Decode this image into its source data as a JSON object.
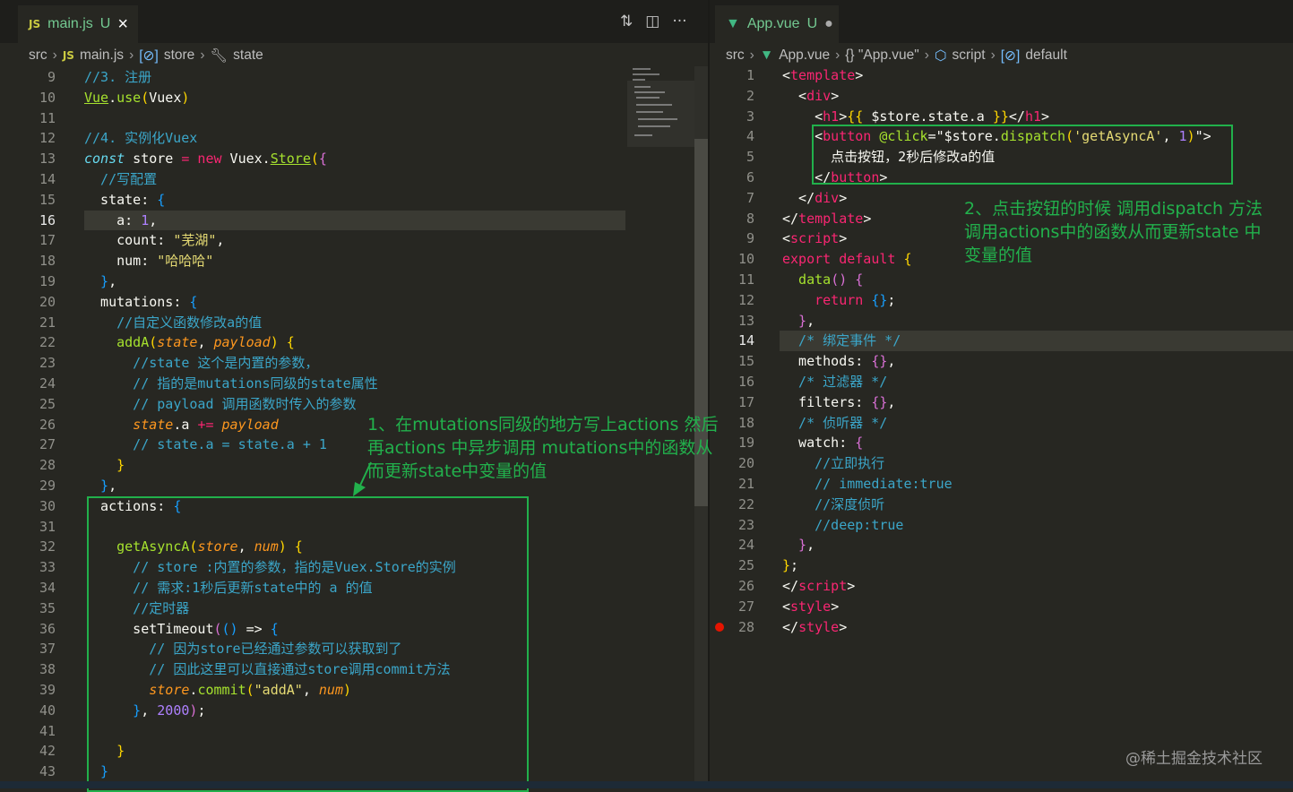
{
  "left": {
    "tab": {
      "icon": "js-icon",
      "label": "main.js",
      "status": "U",
      "close": "×"
    },
    "actions": [
      "compare-changes-icon",
      "split-editor-icon",
      "more-actions-icon"
    ],
    "breadcrumb": [
      "src",
      "main.js",
      "store",
      "state"
    ],
    "first_line": 9,
    "current_line": 16,
    "lines": [
      [
        [
          "//3. 注册",
          "c"
        ]
      ],
      [
        [
          "Vue",
          "f u"
        ],
        [
          ".",
          "w"
        ],
        [
          "use",
          "f"
        ],
        [
          "(",
          "b1"
        ],
        [
          "Vuex",
          "w"
        ],
        [
          ")",
          "b1"
        ]
      ],
      [],
      [
        [
          "//4. 实例化Vuex",
          "c"
        ]
      ],
      [
        [
          "const",
          "kc"
        ],
        [
          " store ",
          "w"
        ],
        [
          "=",
          "k"
        ],
        [
          " new",
          "k"
        ],
        [
          " Vuex.",
          "w"
        ],
        [
          "Store",
          "f u"
        ],
        [
          "(",
          "b1"
        ],
        [
          "{",
          "b2"
        ]
      ],
      [
        [
          "  //写配置",
          "c"
        ]
      ],
      [
        [
          "  state: ",
          "w"
        ],
        [
          "{",
          "b3"
        ]
      ],
      [
        [
          "    a: ",
          "w"
        ],
        [
          "1",
          "n"
        ],
        [
          ",",
          "w"
        ]
      ],
      [
        [
          "    count: ",
          "w"
        ],
        [
          "\"芜湖\"",
          "s"
        ],
        [
          ",",
          "w"
        ]
      ],
      [
        [
          "    num: ",
          "w"
        ],
        [
          "\"哈哈哈\"",
          "s"
        ]
      ],
      [
        [
          "  }",
          "b3"
        ],
        [
          ",",
          "w"
        ]
      ],
      [
        [
          "  mutations: ",
          "w"
        ],
        [
          "{",
          "b3"
        ]
      ],
      [
        [
          "    //自定义函数修改a的值",
          "c"
        ]
      ],
      [
        [
          "    addA",
          "f"
        ],
        [
          "(",
          "b1"
        ],
        [
          "state",
          "p"
        ],
        [
          ", ",
          "w"
        ],
        [
          "payload",
          "p"
        ],
        [
          ")",
          "b1"
        ],
        [
          " {",
          "b1"
        ]
      ],
      [
        [
          "      //state 这个是内置的参数，",
          "c"
        ]
      ],
      [
        [
          "      // 指的是mutations同级的state属性",
          "c"
        ]
      ],
      [
        [
          "      // payload 调用函数时传入的参数",
          "c"
        ]
      ],
      [
        [
          "      state",
          "p"
        ],
        [
          ".a ",
          "w"
        ],
        [
          "+=",
          "k"
        ],
        [
          " payload",
          "p"
        ]
      ],
      [
        [
          "      // state.a = state.a + 1",
          "c"
        ]
      ],
      [
        [
          "    }",
          "b1"
        ]
      ],
      [
        [
          "  }",
          "b3"
        ],
        [
          ",",
          "w"
        ]
      ],
      [
        [
          "  actions: ",
          "w"
        ],
        [
          "{",
          "b3"
        ]
      ],
      [],
      [
        [
          "    getAsyncA",
          "f"
        ],
        [
          "(",
          "b1"
        ],
        [
          "store",
          "p"
        ],
        [
          ", ",
          "w"
        ],
        [
          "num",
          "p"
        ],
        [
          ")",
          "b1"
        ],
        [
          " {",
          "b1"
        ]
      ],
      [
        [
          "      // store :内置的参数，指的是Vuex.Store的实例",
          "c"
        ]
      ],
      [
        [
          "      // 需求:1秒后更新state中的 a 的值",
          "c"
        ]
      ],
      [
        [
          "      //定时器",
          "c"
        ]
      ],
      [
        [
          "      setTimeout",
          "w"
        ],
        [
          "(",
          "b2"
        ],
        [
          "()",
          "b3"
        ],
        [
          " => ",
          "w"
        ],
        [
          "{",
          "b3"
        ]
      ],
      [
        [
          "        // 因为store已经通过参数可以获取到了",
          "c"
        ]
      ],
      [
        [
          "        // 因此这里可以直接通过store调用commit方法",
          "c"
        ]
      ],
      [
        [
          "        store",
          "p"
        ],
        [
          ".",
          "w"
        ],
        [
          "commit",
          "f"
        ],
        [
          "(",
          "b1"
        ],
        [
          "\"addA\"",
          "s"
        ],
        [
          ", ",
          "w"
        ],
        [
          "num",
          "p"
        ],
        [
          ")",
          "b1"
        ]
      ],
      [
        [
          "      }",
          "b3"
        ],
        [
          ", ",
          "w"
        ],
        [
          "2000",
          "n"
        ],
        [
          ")",
          "b2"
        ],
        [
          ";",
          "w"
        ]
      ],
      [],
      [
        [
          "    }",
          "b1"
        ]
      ],
      [
        [
          "  }",
          "b3"
        ]
      ]
    ],
    "annotation": "1、在mutations同级的地方写上actions 然后再actions 中异步调用 mutations中的函数从而更新state中变量的值"
  },
  "right": {
    "tab": {
      "icon": "vue-icon",
      "label": "App.vue",
      "status": "U",
      "modified": "●"
    },
    "breadcrumb": [
      "src",
      "App.vue",
      "{} \"App.vue\"",
      "script",
      "default"
    ],
    "first_line": 1,
    "current_line": 14,
    "breakpoint_line": 28,
    "lines": [
      [
        [
          "<",
          "w"
        ],
        [
          "template",
          "t"
        ],
        [
          ">",
          "w"
        ]
      ],
      [
        [
          "  <",
          "w"
        ],
        [
          "div",
          "t"
        ],
        [
          ">",
          "w"
        ]
      ],
      [
        [
          "    <",
          "w"
        ],
        [
          "h1",
          "t"
        ],
        [
          ">",
          "w"
        ],
        [
          "{{",
          "b1"
        ],
        [
          " $store.state.a ",
          "w"
        ],
        [
          "}}",
          "b1"
        ],
        [
          "</",
          "w"
        ],
        [
          "h1",
          "t"
        ],
        [
          ">",
          "w"
        ]
      ],
      [
        [
          "    <",
          "w"
        ],
        [
          "button",
          "t"
        ],
        [
          " @click",
          "f"
        ],
        [
          "=\"$store.",
          "w"
        ],
        [
          "dispatch",
          "f"
        ],
        [
          "(",
          "b1"
        ],
        [
          "'getAsyncA'",
          "s"
        ],
        [
          ", ",
          "w"
        ],
        [
          "1",
          "n"
        ],
        [
          ")",
          "b1"
        ],
        [
          "\">",
          "w"
        ]
      ],
      [
        [
          "      点击按钮，2秒后修改a的值",
          "w"
        ]
      ],
      [
        [
          "    </",
          "w"
        ],
        [
          "button",
          "t"
        ],
        [
          ">",
          "w"
        ]
      ],
      [
        [
          "  </",
          "w"
        ],
        [
          "div",
          "t"
        ],
        [
          ">",
          "w"
        ]
      ],
      [
        [
          "</",
          "w"
        ],
        [
          "template",
          "t"
        ],
        [
          ">",
          "w"
        ]
      ],
      [
        [
          "<",
          "w"
        ],
        [
          "script",
          "t"
        ],
        [
          ">",
          "w"
        ]
      ],
      [
        [
          "export default",
          "k"
        ],
        [
          " {",
          "b1"
        ]
      ],
      [
        [
          "  data",
          "f"
        ],
        [
          "()",
          "b2"
        ],
        [
          " {",
          "b2"
        ]
      ],
      [
        [
          "    return",
          "k"
        ],
        [
          " {}",
          "b3"
        ],
        [
          ";",
          "w"
        ]
      ],
      [
        [
          "  }",
          "b2"
        ],
        [
          ",",
          "w"
        ]
      ],
      [
        [
          "  /* 绑定事件 */",
          "c"
        ]
      ],
      [
        [
          "  methods: ",
          "w"
        ],
        [
          "{}",
          "b2"
        ],
        [
          ",",
          "w"
        ]
      ],
      [
        [
          "  /* 过滤器 */",
          "c"
        ]
      ],
      [
        [
          "  filters: ",
          "w"
        ],
        [
          "{}",
          "b2"
        ],
        [
          ",",
          "w"
        ]
      ],
      [
        [
          "  /* 侦听器 */",
          "c"
        ]
      ],
      [
        [
          "  watch: ",
          "w"
        ],
        [
          "{",
          "b2"
        ]
      ],
      [
        [
          "    //立即执行",
          "c"
        ]
      ],
      [
        [
          "    // immediate:true",
          "c"
        ]
      ],
      [
        [
          "    //深度侦听",
          "c"
        ]
      ],
      [
        [
          "    //deep:true",
          "c"
        ]
      ],
      [
        [
          "  }",
          "b2"
        ],
        [
          ",",
          "w"
        ]
      ],
      [
        [
          "}",
          "b1"
        ],
        [
          ";",
          "w"
        ]
      ],
      [
        [
          "</",
          "w"
        ],
        [
          "script",
          "t"
        ],
        [
          ">",
          "w"
        ]
      ],
      [
        [
          "<",
          "w"
        ],
        [
          "style",
          "t"
        ],
        [
          ">",
          "w"
        ]
      ],
      [
        [
          "</",
          "w"
        ],
        [
          "style",
          "t"
        ],
        [
          ">",
          "w"
        ]
      ]
    ],
    "annotation": "2、点击按钮的时候 调用dispatch 方法调用actions中的函数从而更新state 中变量的值"
  },
  "watermark": "@稀土掘金技术社区",
  "colors": {
    "annotation": "#22b14c",
    "background": "#272722",
    "keyword": "#f92672",
    "comment": "#3ba6c9"
  }
}
